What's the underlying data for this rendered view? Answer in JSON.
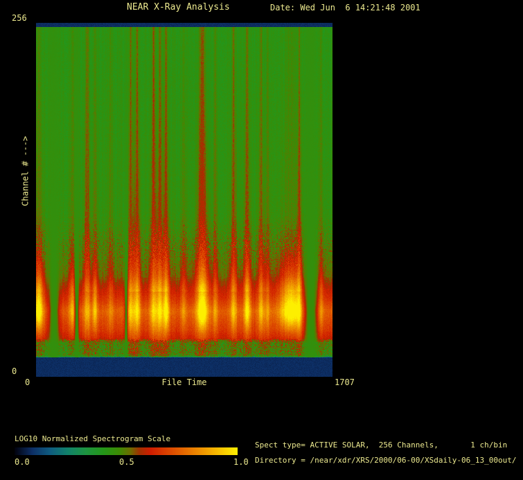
{
  "window": {
    "background": "#000000",
    "text_color": "#ece98f"
  },
  "header": {
    "title": "NEAR X-Ray Analysis",
    "date": "Date: Wed Jun  6 14:21:48 2001"
  },
  "plot": {
    "y_axis_label": "Channel # --->",
    "y_max_label": "256",
    "y_min_label": "0",
    "x_min_label": "0",
    "x_axis_label": "File Time",
    "x_max_label": "1707"
  },
  "colorbar": {
    "title": "LOG10 Normalized Spectrogram Scale",
    "tick_labels": [
      "0.0",
      "0.5",
      "1.0"
    ]
  },
  "footer": {
    "line1": "Spect type= ACTIVE SOLAR,  256 Channels,       1 ch/bin",
    "line2": "Directory = /near/xdr/XRS/2000/06-00/XSdaily-06_13_00out/"
  },
  "chart_data": {
    "type": "heatmap",
    "title": "NEAR X-Ray Analysis",
    "xlabel": "File Time",
    "ylabel": "Channel #",
    "x_range": [
      0,
      1707
    ],
    "y_range": [
      0,
      256
    ],
    "channels": 256,
    "ch_per_bin": 1,
    "scale_label": "LOG10 Normalized Spectrogram Scale",
    "scale_range": [
      0.0,
      1.0
    ],
    "scale_ticks": [
      0.0,
      0.5,
      1.0
    ],
    "colormap": [
      {
        "t": 0.0,
        "color": "#01010c"
      },
      {
        "t": 0.08,
        "color": "#0d2f66"
      },
      {
        "t": 0.16,
        "color": "#0f5c80"
      },
      {
        "t": 0.24,
        "color": "#11826a"
      },
      {
        "t": 0.32,
        "color": "#1d9440"
      },
      {
        "t": 0.4,
        "color": "#249618"
      },
      {
        "t": 0.47,
        "color": "#3d8a04"
      },
      {
        "t": 0.52,
        "color": "#6d6c00"
      },
      {
        "t": 0.56,
        "color": "#a03000"
      },
      {
        "t": 0.61,
        "color": "#cf1d00"
      },
      {
        "t": 0.72,
        "color": "#df5300"
      },
      {
        "t": 0.82,
        "color": "#ec8800"
      },
      {
        "t": 0.91,
        "color": "#f7bb00"
      },
      {
        "t": 1.0,
        "color": "#fdef00"
      }
    ],
    "top_navy_frac": 0.99,
    "bottom_navy_frac": 0.053,
    "navy_value": 0.075,
    "gap_fill_value": 0.44,
    "base_profile": [
      [
        0.0,
        0.075
      ],
      [
        0.053,
        0.075
      ],
      [
        0.057,
        0.4
      ],
      [
        0.062,
        0.45
      ],
      [
        0.096,
        0.46
      ],
      [
        0.108,
        0.6
      ],
      [
        0.132,
        0.66
      ],
      [
        0.185,
        0.74
      ],
      [
        0.215,
        0.66
      ],
      [
        0.245,
        0.6
      ],
      [
        0.285,
        0.52
      ],
      [
        0.34,
        0.485
      ],
      [
        0.4,
        0.46
      ],
      [
        0.46,
        0.435
      ],
      [
        0.97,
        0.42
      ],
      [
        1.0,
        0.42
      ]
    ],
    "flares": [
      {
        "t": 16,
        "w": 18,
        "s": 0.5,
        "hot": 0.95
      },
      {
        "t": 211,
        "w": 14,
        "s": 0.35,
        "hot": 0.5
      },
      {
        "t": 295,
        "w": 13,
        "s": 0.75,
        "hot": 0.35
      },
      {
        "t": 339,
        "w": 10,
        "s": 0.45,
        "hot": 0.55
      },
      {
        "t": 431,
        "w": 11,
        "s": 0.3,
        "hot": 0.2
      },
      {
        "t": 546,
        "w": 13,
        "s": 0.8,
        "hot": 0.5
      },
      {
        "t": 582,
        "w": 13,
        "s": 0.85,
        "hot": 0.6
      },
      {
        "t": 678,
        "w": 15,
        "s": 0.9,
        "hot": 0.5
      },
      {
        "t": 714,
        "w": 13,
        "s": 0.9,
        "hot": 0.6
      },
      {
        "t": 750,
        "w": 12,
        "s": 0.8,
        "hot": 0.75
      },
      {
        "t": 850,
        "w": 10,
        "s": 0.4,
        "hot": 0.3
      },
      {
        "t": 957,
        "w": 24,
        "s": 1.0,
        "hot": 0.9
      },
      {
        "t": 1033,
        "w": 10,
        "s": 0.45,
        "hot": 0.3
      },
      {
        "t": 1137,
        "w": 13,
        "s": 0.75,
        "hot": 0.45
      },
      {
        "t": 1216,
        "w": 13,
        "s": 0.8,
        "hot": 0.7
      },
      {
        "t": 1296,
        "w": 12,
        "s": 0.7,
        "hot": 0.45
      },
      {
        "t": 1332,
        "w": 10,
        "s": 0.5,
        "hot": 0.3
      },
      {
        "t": 1468,
        "w": 48,
        "s": 0.3,
        "hot": 1.0
      },
      {
        "t": 1516,
        "w": 9,
        "s": 0.8,
        "hot": 0.35
      },
      {
        "t": 1639,
        "w": 12,
        "s": 0.45,
        "hot": 0.4
      }
    ],
    "gaps": [
      {
        "t": 104,
        "w": 45
      },
      {
        "t": 235,
        "w": 18
      },
      {
        "t": 519,
        "w": 12
      },
      {
        "t": 1583,
        "w": 55
      }
    ],
    "legend_position": "none",
    "grid": false
  }
}
